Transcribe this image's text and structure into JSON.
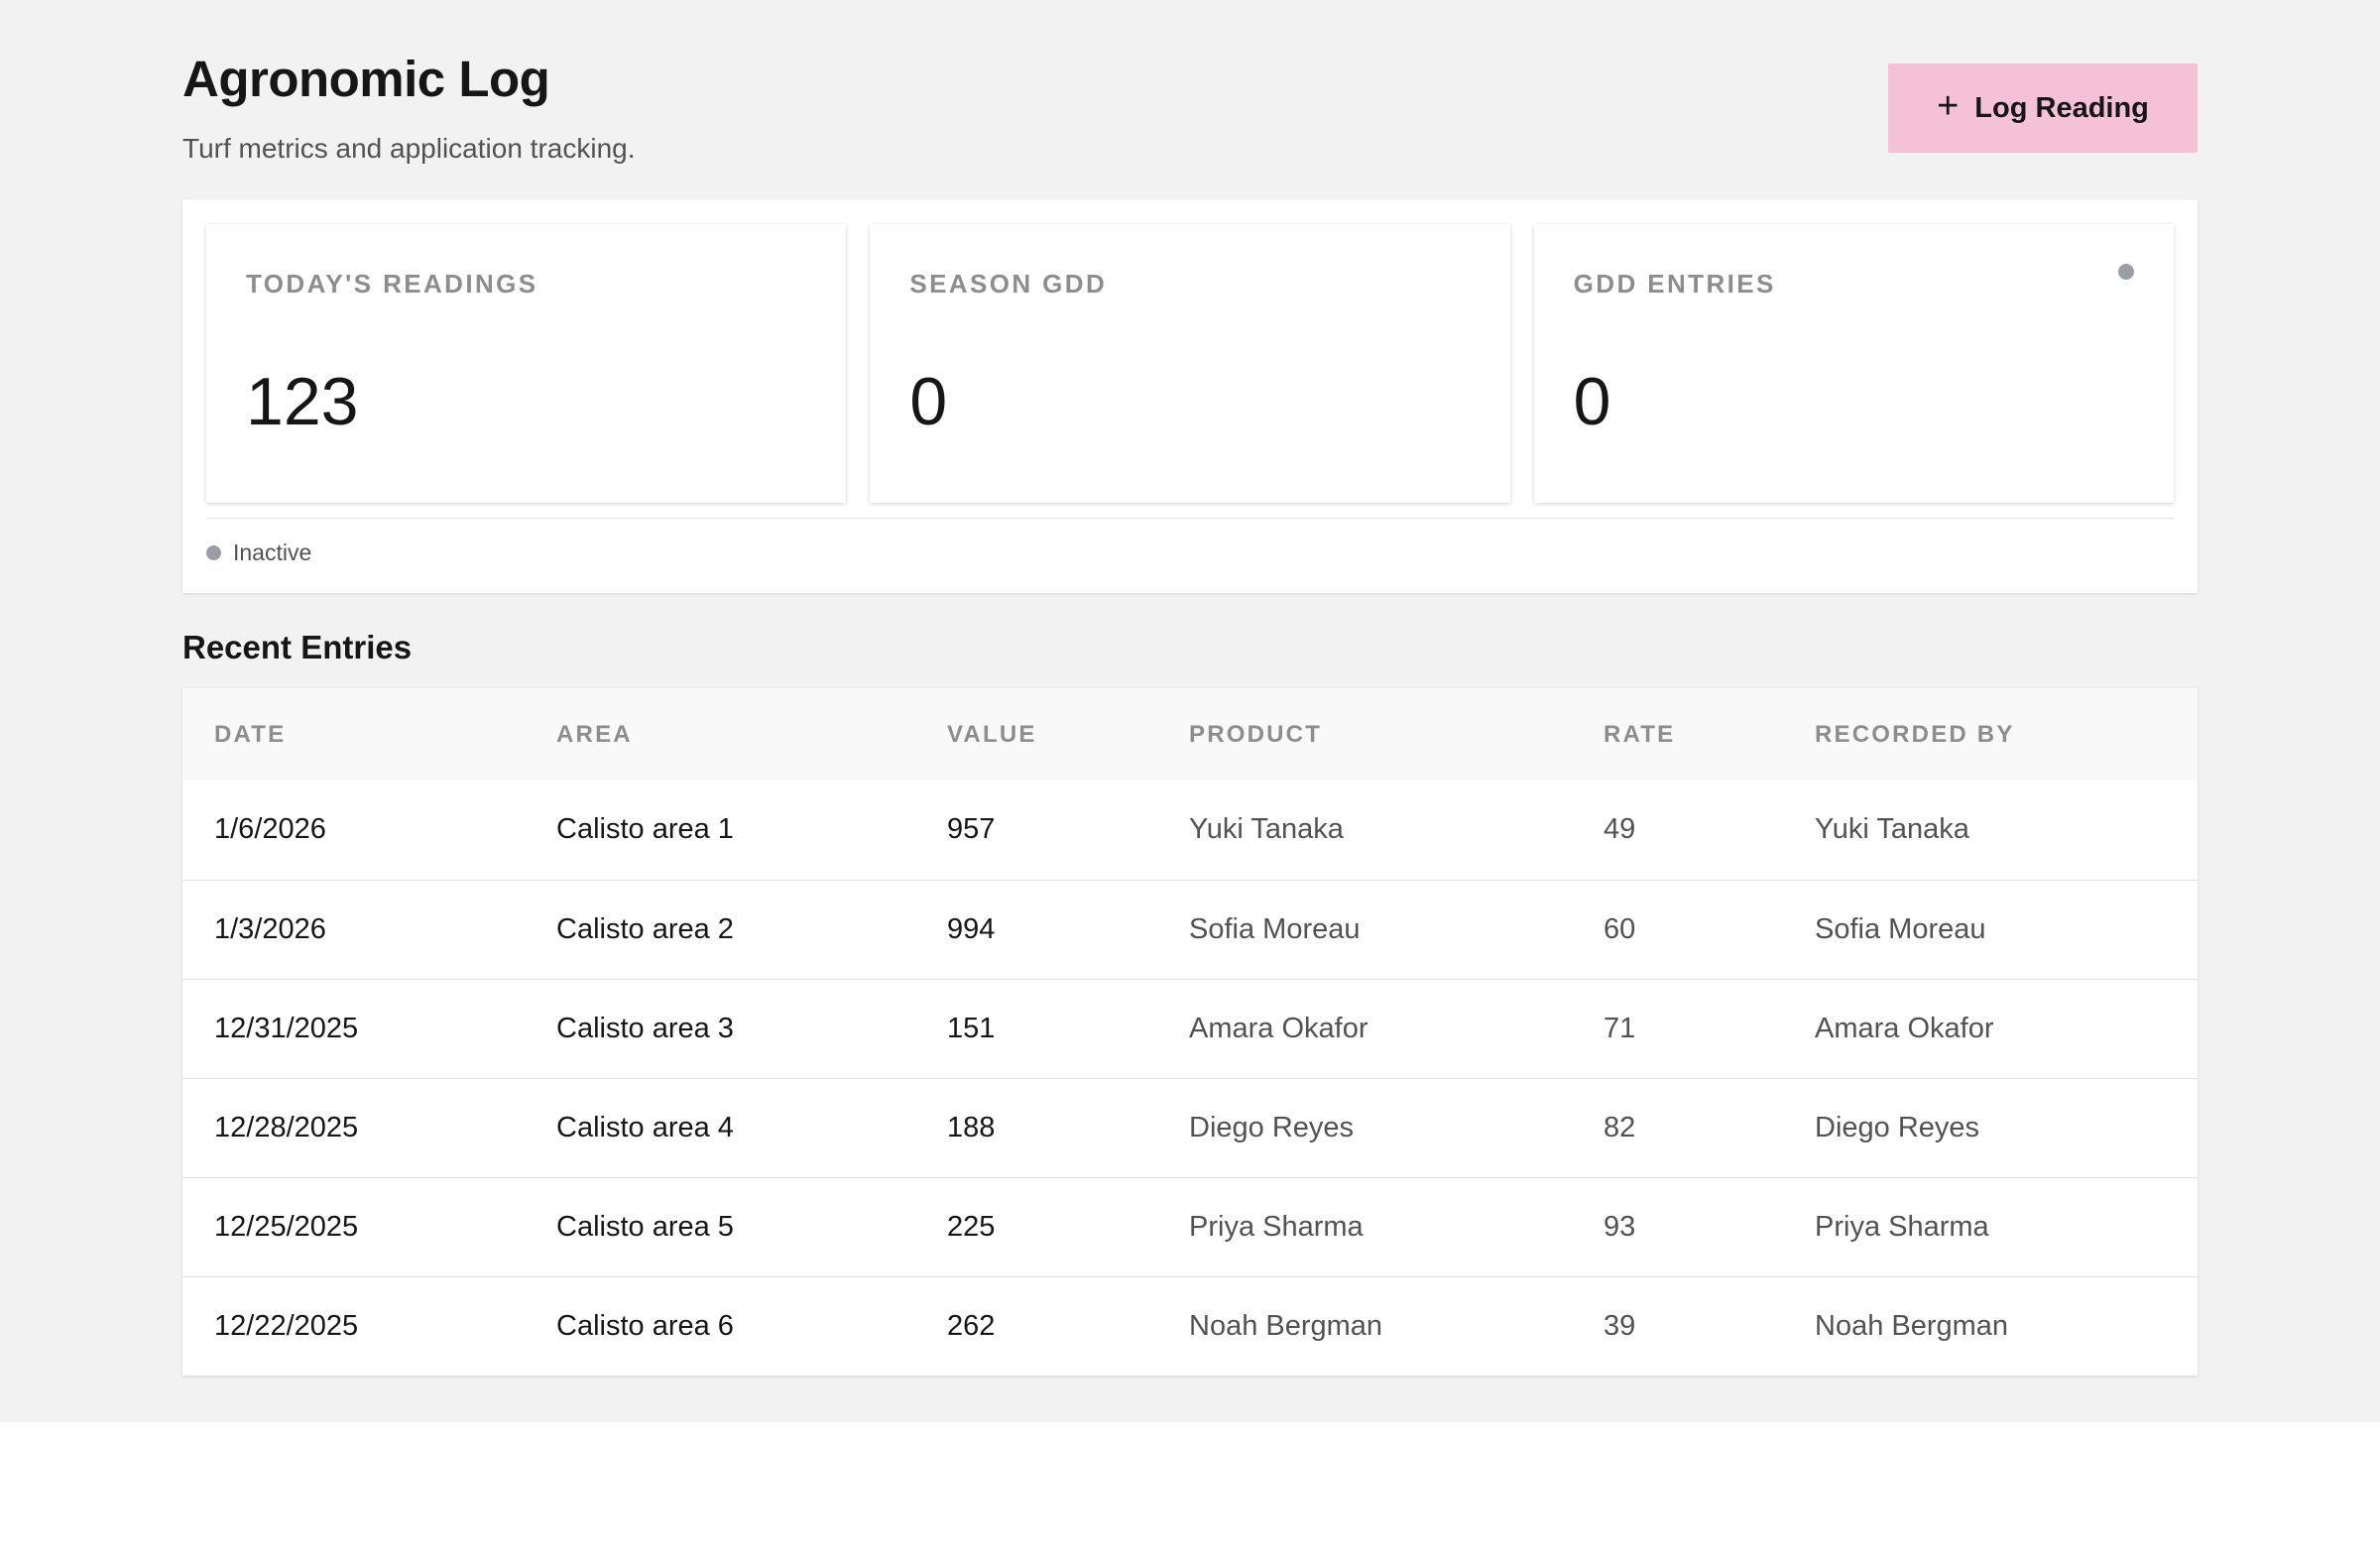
{
  "header": {
    "title": "Agronomic Log",
    "subtitle": "Turf metrics and application tracking.",
    "primary_action_label": "Log Reading"
  },
  "metrics": [
    {
      "label": "TODAY'S READINGS",
      "value": "123"
    },
    {
      "label": "SEASON GDD",
      "value": "0"
    },
    {
      "label": "GDD ENTRIES",
      "value": "0"
    }
  ],
  "status": {
    "label": "Inactive",
    "color": "#9a9ca6"
  },
  "recent_entries": {
    "title": "Recent Entries",
    "columns": [
      "DATE",
      "AREA",
      "VALUE",
      "PRODUCT",
      "RATE",
      "RECORDED BY"
    ],
    "rows": [
      {
        "date": "1/6/2026",
        "area": "Calisto area 1",
        "value": "957",
        "product": "Yuki Tanaka",
        "rate": "49",
        "recorded_by": "Yuki Tanaka"
      },
      {
        "date": "1/3/2026",
        "area": "Calisto area 2",
        "value": "994",
        "product": "Sofia Moreau",
        "rate": "60",
        "recorded_by": "Sofia Moreau"
      },
      {
        "date": "12/31/2025",
        "area": "Calisto area 3",
        "value": "151",
        "product": "Amara Okafor",
        "rate": "71",
        "recorded_by": "Amara Okafor"
      },
      {
        "date": "12/28/2025",
        "area": "Calisto area 4",
        "value": "188",
        "product": "Diego Reyes",
        "rate": "82",
        "recorded_by": "Diego Reyes"
      },
      {
        "date": "12/25/2025",
        "area": "Calisto area 5",
        "value": "225",
        "product": "Priya Sharma",
        "rate": "93",
        "recorded_by": "Priya Sharma"
      },
      {
        "date": "12/22/2025",
        "area": "Calisto area 6",
        "value": "262",
        "product": "Noah Bergman",
        "rate": "39",
        "recorded_by": "Noah Bergman"
      }
    ]
  },
  "colors": {
    "accent_button": "#f5c1d7",
    "page_background": "#f2f2f2",
    "indicator_dot": "#9a9ca6"
  }
}
